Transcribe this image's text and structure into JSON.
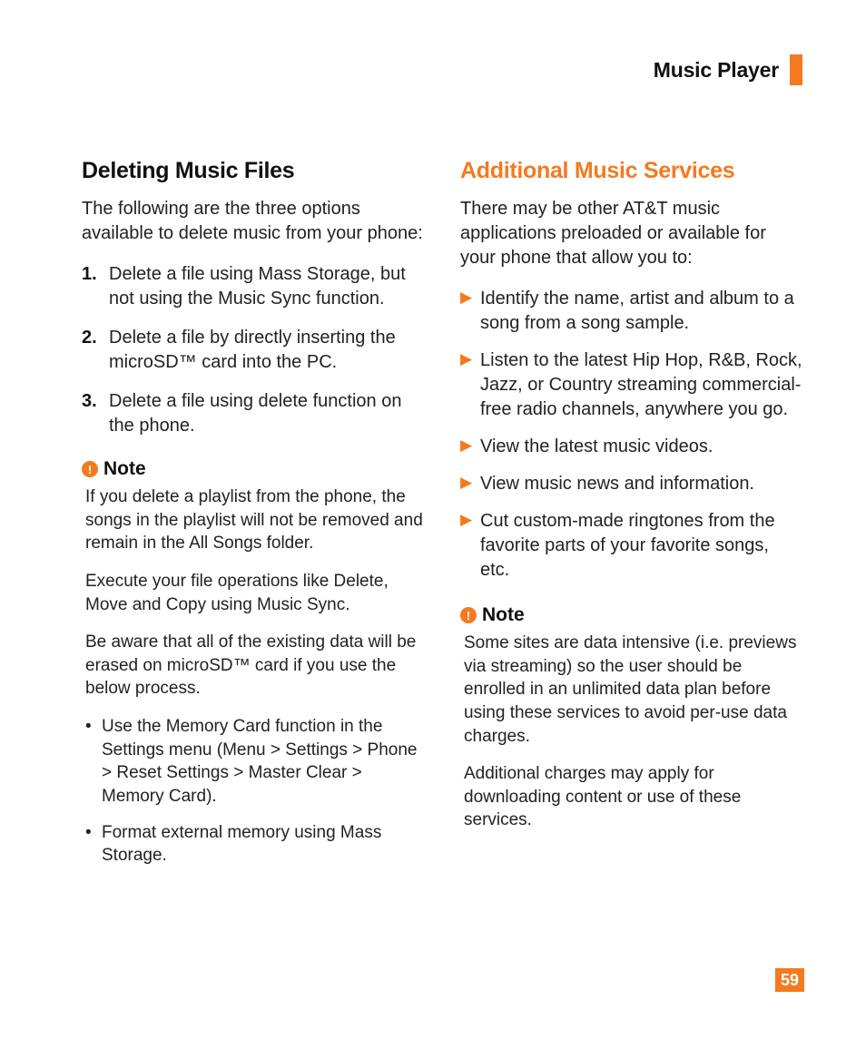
{
  "header": {
    "title": "Music Player"
  },
  "page_number": "59",
  "left": {
    "heading": "Deleting Music Files",
    "intro": "The following are the three options available to delete music from your phone:",
    "steps": [
      {
        "num": "1.",
        "text": "Delete a file using Mass Storage, but not using the Music Sync function."
      },
      {
        "num": "2.",
        "text": "Delete a file by directly inserting the microSD™ card into the PC."
      },
      {
        "num": "3.",
        "text": "Delete a file using delete function on the phone."
      }
    ],
    "note": {
      "label": "Note",
      "paras": [
        "If you delete a playlist from the phone, the songs in the playlist will not be removed and remain in the All Songs folder.",
        "Execute your file operations like Delete, Move and Copy using Music Sync.",
        "Be aware that all of the existing data will be erased on microSD™ card if you use the below process."
      ],
      "bullets": [
        "Use the Memory Card function in the Settings menu (Menu > Settings > Phone > Reset Settings > Master Clear > Memory Card).",
        "Format external memory using Mass Storage."
      ]
    }
  },
  "right": {
    "heading": "Additional Music Services",
    "intro": "There may be other AT&T music applications preloaded or available for your phone that allow you to:",
    "items": [
      "Identify the name, artist and album to a song from a song sample.",
      "Listen to the latest Hip Hop, R&B, Rock, Jazz, or Country streaming commercial-free radio channels, anywhere you go.",
      "View the latest music videos.",
      "View music news and information.",
      "Cut custom-made ringtones from the favorite parts of your favorite songs, etc."
    ],
    "note": {
      "label": "Note",
      "paras": [
        "Some sites are data intensive (i.e. previews via streaming) so the user should be enrolled in an unlimited data plan before using these services to avoid per-use data charges.",
        "Additional charges may apply for downloading content or use of these services."
      ]
    }
  }
}
